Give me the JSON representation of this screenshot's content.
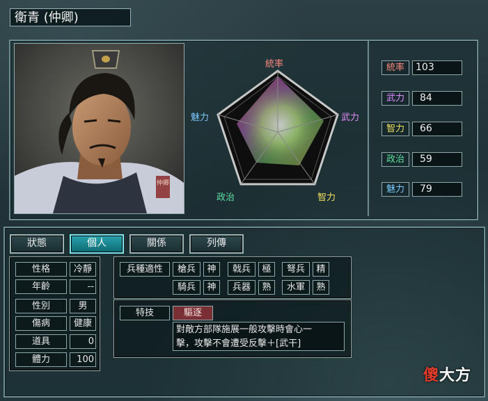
{
  "header": {
    "name": "衛青 (仲卿)"
  },
  "radar": {
    "labels": {
      "lead": "統率",
      "war": "武力",
      "int": "智力",
      "pol": "政治",
      "chr": "魅力"
    },
    "colors": {
      "lead": "#ff8a80",
      "war": "#e08aff",
      "int": "#f0e060",
      "pol": "#5ee0a0",
      "chr": "#7ac8ff"
    }
  },
  "stats": [
    {
      "label": "統率",
      "value": "103",
      "color": "#ff8a80"
    },
    {
      "label": "武力",
      "value": "84",
      "color": "#e08aff"
    },
    {
      "label": "智力",
      "value": "66",
      "color": "#f0e060"
    },
    {
      "label": "政治",
      "value": "59",
      "color": "#5ee0a0"
    },
    {
      "label": "魅力",
      "value": "79",
      "color": "#7ac8ff"
    }
  ],
  "tabs": [
    "狀態",
    "個人",
    "關係",
    "列傳"
  ],
  "active_tab": "個人",
  "personal": [
    {
      "label": "性格",
      "value": "冷靜"
    },
    {
      "label": "年齡",
      "value": "--"
    },
    {
      "label": "性別",
      "value": "男"
    },
    {
      "label": "傷病",
      "value": "健康"
    },
    {
      "label": "道具",
      "value": "0"
    },
    {
      "label": "體力",
      "value": "100"
    }
  ],
  "aptitude": {
    "header": "兵種適性",
    "rows": [
      [
        {
          "unit": "槍兵",
          "grade": "神"
        },
        {
          "unit": "戟兵",
          "grade": "極"
        },
        {
          "unit": "弩兵",
          "grade": "精"
        }
      ],
      [
        {
          "unit": "騎兵",
          "grade": "神"
        },
        {
          "unit": "兵器",
          "grade": "熟"
        },
        {
          "unit": "水軍",
          "grade": "熟"
        }
      ]
    ]
  },
  "skill": {
    "label": "特技",
    "name": "驅逐",
    "desc_line1": "對敵方部隊施展一般攻擊時會心一",
    "desc_line2": "擊，攻擊不會遭受反擊＋[武干]"
  },
  "portrait": {
    "seal": "仲卿"
  },
  "watermark": {
    "red": "傻",
    "white": "大方"
  }
}
